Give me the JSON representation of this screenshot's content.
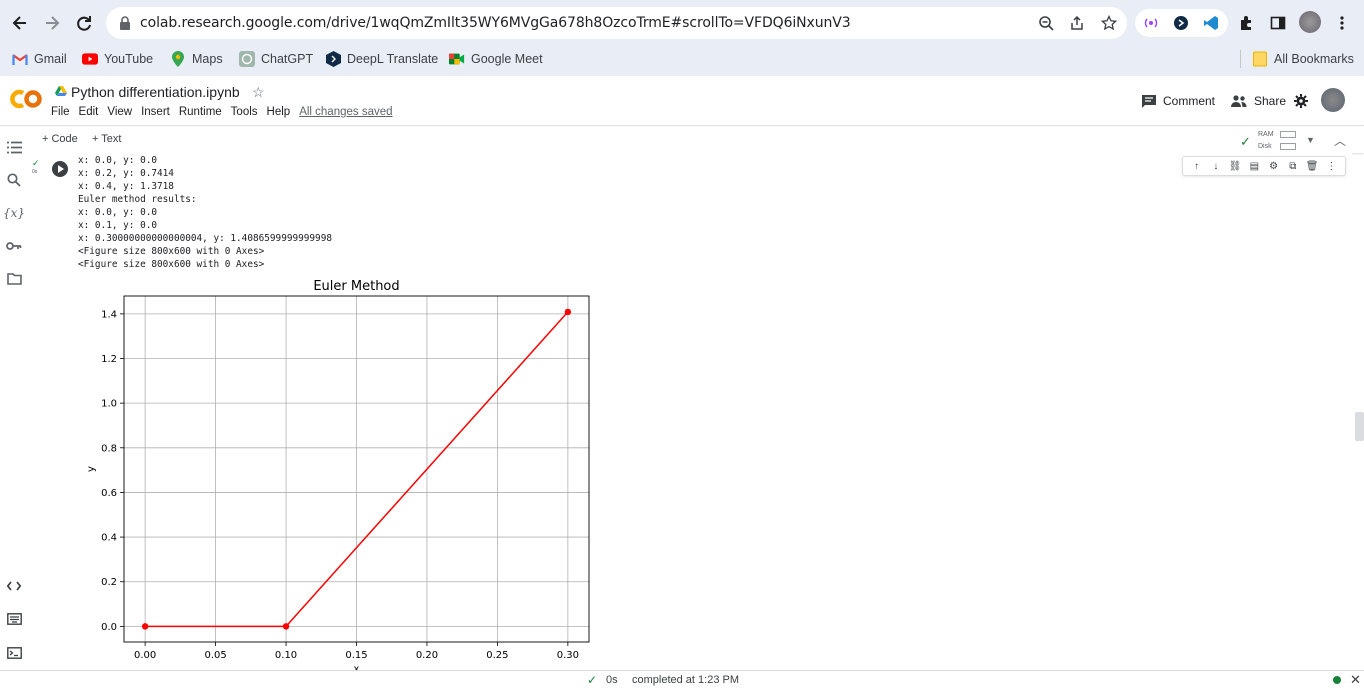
{
  "browser": {
    "url": "colab.research.google.com/drive/1wqQmZmIlt35WY6MVgGa678h8OzcoTrmE#scrollTo=VFDQ6iNxunV3",
    "bookmarks": [
      {
        "label": "Gmail",
        "icon": "gmail-icon"
      },
      {
        "label": "YouTube",
        "icon": "youtube-icon"
      },
      {
        "label": "Maps",
        "icon": "maps-icon"
      },
      {
        "label": "ChatGPT",
        "icon": "chatgpt-icon"
      },
      {
        "label": "DeepL Translate",
        "icon": "deepl-icon"
      },
      {
        "label": "Google Meet",
        "icon": "meet-icon"
      }
    ],
    "all_bookmarks": "All Bookmarks"
  },
  "colab": {
    "title": "Python differentiation.ipynb",
    "menu": [
      "File",
      "Edit",
      "View",
      "Insert",
      "Runtime",
      "Tools",
      "Help"
    ],
    "saved_status": "All changes saved",
    "comment": "Comment",
    "share": "Share",
    "add_code": "+ Code",
    "add_text": "+ Text",
    "ram_label": "RAM",
    "disk_label": "Disk"
  },
  "cell": {
    "exec_time": "0s",
    "output_lines": [
      "x: 0.0, y: 0.0",
      "x: 0.2, y: 0.7414",
      "x: 0.4, y: 1.3718",
      "Euler method results:",
      "x: 0.0, y: 0.0",
      "x: 0.1, y: 0.0",
      "x: 0.30000000000000004, y: 1.4086599999999998",
      "<Figure size 800x600 with 0 Axes>",
      "<Figure size 800x600 with 0 Axes>"
    ]
  },
  "chart_data": {
    "type": "line",
    "title": "Euler Method",
    "xlabel": "x",
    "ylabel": "y",
    "x": [
      0.0,
      0.1,
      0.30000000000000004
    ],
    "y": [
      0.0,
      0.0,
      1.4086599999999998
    ],
    "xlim": [
      -0.015,
      0.315
    ],
    "ylim": [
      -0.07,
      1.48
    ],
    "xticks": [
      0.0,
      0.05,
      0.1,
      0.15,
      0.2,
      0.25,
      0.3
    ],
    "xtick_labels": [
      "0.00",
      "0.05",
      "0.10",
      "0.15",
      "0.20",
      "0.25",
      "0.30"
    ],
    "yticks": [
      0.0,
      0.2,
      0.4,
      0.6,
      0.8,
      1.0,
      1.2,
      1.4
    ],
    "ytick_labels": [
      "0.0",
      "0.2",
      "0.4",
      "0.6",
      "0.8",
      "1.0",
      "1.2",
      "1.4"
    ],
    "grid": true,
    "color": "#ff0000",
    "marker": "circle"
  },
  "status": {
    "time": "0s",
    "message": "completed at 1:23 PM"
  }
}
